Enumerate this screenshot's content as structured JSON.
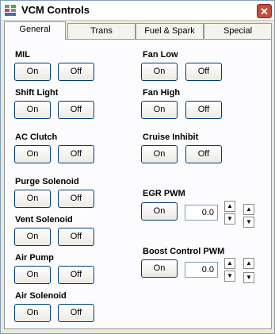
{
  "window": {
    "title": "VCM Controls",
    "close_glyph": "✕"
  },
  "icons": {
    "app": "app-icon",
    "close": "close-icon",
    "up": "up-arrow-icon",
    "down": "down-arrow-icon"
  },
  "tabs": [
    {
      "label": "General",
      "active": true
    },
    {
      "label": "Trans",
      "active": false
    },
    {
      "label": "Fuel & Spark",
      "active": false
    },
    {
      "label": "Special",
      "active": false
    }
  ],
  "controls": {
    "mil": {
      "label": "MIL",
      "on": "On",
      "off": "Off"
    },
    "shift_light": {
      "label": "Shift Light",
      "on": "On",
      "off": "Off"
    },
    "ac_clutch": {
      "label": "AC Clutch",
      "on": "On",
      "off": "Off"
    },
    "purge_solenoid": {
      "label": "Purge Solenoid",
      "on": "On",
      "off": "Off"
    },
    "vent_solenoid": {
      "label": "Vent Solenoid",
      "on": "On",
      "off": "Off"
    },
    "air_pump": {
      "label": "Air Pump",
      "on": "On",
      "off": "Off"
    },
    "air_solenoid": {
      "label": "Air Solenoid",
      "on": "On",
      "off": "Off"
    },
    "fan_low": {
      "label": "Fan Low",
      "on": "On",
      "off": "Off"
    },
    "fan_high": {
      "label": "Fan High",
      "on": "On",
      "off": "Off"
    },
    "cruise_inhibit": {
      "label": "Cruise Inhibit",
      "on": "On",
      "off": "Off"
    },
    "egr_pwm": {
      "label": "EGR PWM",
      "on": "On",
      "value": "0.0"
    },
    "boost_pwm": {
      "label": "Boost Control PWM",
      "on": "On",
      "value": "0.0"
    }
  }
}
